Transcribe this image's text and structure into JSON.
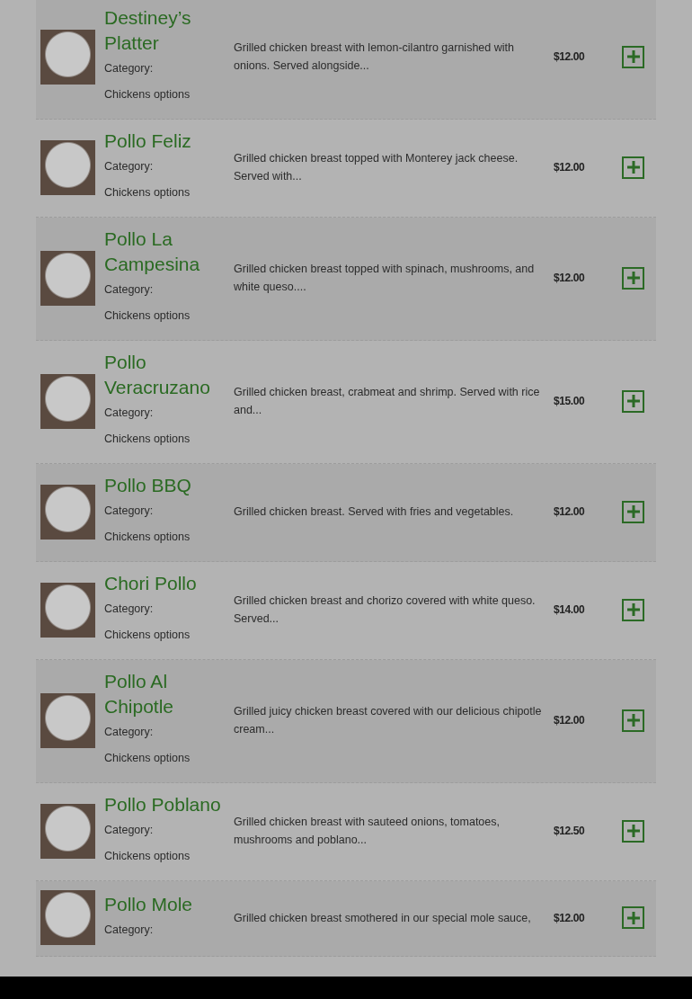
{
  "items": [
    {
      "name": "Destiney’s Platter",
      "category_label": "Category:",
      "category": "Chickens options",
      "description": "Grilled chicken breast with lemon-cilantro garnished with onions. Served alongside...",
      "price": "$12.00"
    },
    {
      "name": "Pollo Feliz",
      "category_label": "Category:",
      "category": "Chickens options",
      "description": "Grilled chicken breast topped with Monterey jack cheese. Served with...",
      "price": "$12.00"
    },
    {
      "name": "Pollo La Campesina",
      "category_label": "Category:",
      "category": "Chickens options",
      "description": "Grilled chicken breast topped with spinach, mushrooms, and white queso....",
      "price": "$12.00"
    },
    {
      "name": "Pollo Veracruzano",
      "category_label": "Category:",
      "category": "Chickens options",
      "description": "Grilled chicken breast, crabmeat and shrimp. Served with rice and...",
      "price": "$15.00"
    },
    {
      "name": "Pollo BBQ",
      "category_label": "Category:",
      "category": "Chickens options",
      "description": "Grilled chicken breast. Served with fries and vegetables.",
      "price": "$12.00"
    },
    {
      "name": "Chori Pollo",
      "category_label": "Category:",
      "category": "Chickens options",
      "description": "Grilled chicken breast and chorizo covered with white queso. Served...",
      "price": "$14.00"
    },
    {
      "name": "Pollo Al Chipotle",
      "category_label": "Category:",
      "category": "Chickens options",
      "description": "Grilled juicy chicken breast covered with our delicious chipotle cream...",
      "price": "$12.00"
    },
    {
      "name": "Pollo Poblano",
      "category_label": "Category:",
      "category": "Chickens options",
      "description": "Grilled chicken breast with sauteed onions, tomatoes, mushrooms and poblano...",
      "price": "$12.50"
    },
    {
      "name": "Pollo Mole",
      "category_label": "Category:",
      "description": "Grilled chicken breast smothered in our special mole sauce,",
      "price": "$12.00"
    }
  ]
}
